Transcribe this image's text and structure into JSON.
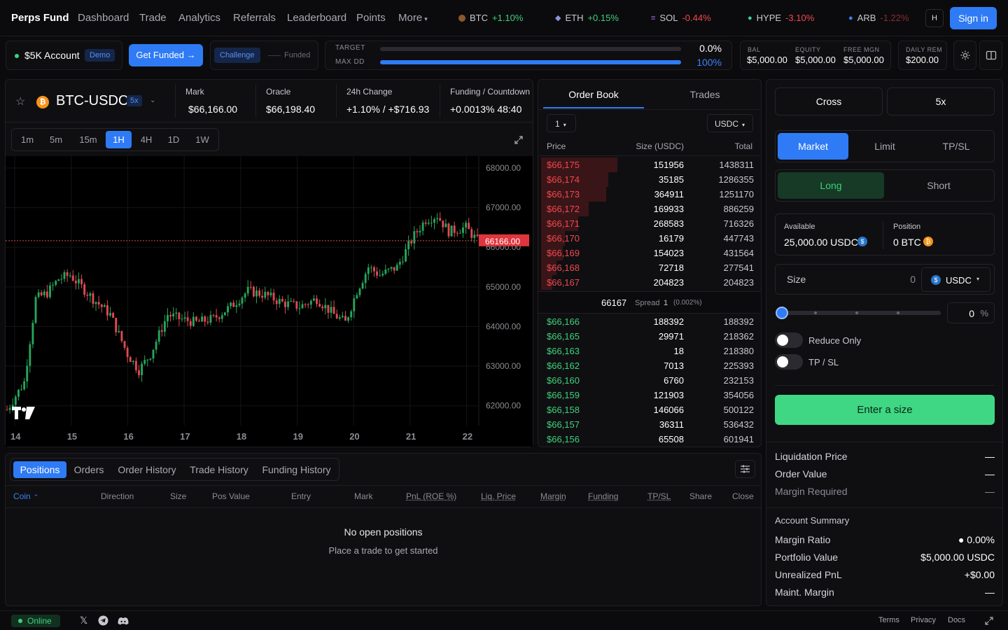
{
  "nav": {
    "brand": "Perps Fund",
    "links": [
      "Dashboard",
      "Trade",
      "Analytics",
      "Referrals",
      "Leaderboard",
      "Points",
      "More"
    ],
    "tickers": [
      {
        "sym": "BTC",
        "chg": "+1.10%",
        "dir": "up",
        "color": "#8a5a2b"
      },
      {
        "sym": "ETH",
        "chg": "+0.15%",
        "dir": "up",
        "color": "#6c7bd6"
      },
      {
        "sym": "SOL",
        "chg": "-0.44%",
        "dir": "down",
        "color": "#9b6cf0"
      },
      {
        "sym": "HYPE",
        "chg": "-3.10%",
        "dir": "down",
        "color": "#36d3a5"
      },
      {
        "sym": "ARB",
        "chg": "-1.22%",
        "dir": "down",
        "color": "#3b82f6"
      }
    ],
    "h_label": "H",
    "signin": "Sign in"
  },
  "account": {
    "name": "$5K Account",
    "badge": "Demo",
    "get_funded": "Get Funded →",
    "challenge": "Challenge",
    "funded": "Funded",
    "target_label": "TARGET",
    "target_value": "0.0%",
    "target_progress": 0.0,
    "maxdd_label": "MAX DD",
    "maxdd_value": "100%",
    "maxdd_progress": 1.0,
    "stats": [
      {
        "label": "BAL",
        "value": "$5,000.00"
      },
      {
        "label": "EQUITY",
        "value": "$5,000.00"
      },
      {
        "label": "FREE MGN",
        "value": "$5,000.00"
      }
    ],
    "daily_label": "DAILY REM",
    "daily_value": "$200.00"
  },
  "market": {
    "pair": "BTC-USDC",
    "leverage": "5x",
    "mark_label": "Mark",
    "mark": "$66,166.00",
    "oracle_label": "Oracle",
    "oracle": "$66,198.40",
    "change_label": "24h Change",
    "change": "+1.10% / +$716.93",
    "funding_label": "Funding / Countdown",
    "funding": "+0.0013% 48:40"
  },
  "timeframes": [
    "1m",
    "5m",
    "15m",
    "1H",
    "4H",
    "1D",
    "1W"
  ],
  "active_timeframe": "1H",
  "chart_data": {
    "type": "candlestick",
    "y_ticks": [
      "68000.00",
      "67000.00",
      "66000.00",
      "65000.00",
      "64000.00",
      "63000.00",
      "62000.00"
    ],
    "x_ticks": [
      "14",
      "15",
      "16",
      "17",
      "18",
      "19",
      "20",
      "21",
      "22"
    ],
    "last_price_label": "66166.00",
    "last_price": 66166,
    "ylim": [
      61500,
      68300
    ],
    "trend": [
      [
        0,
        61900
      ],
      [
        6,
        62600
      ],
      [
        10,
        64700
      ],
      [
        14,
        64850
      ],
      [
        18,
        65200
      ],
      [
        22,
        65300
      ],
      [
        26,
        65000
      ],
      [
        30,
        64700
      ],
      [
        36,
        64300
      ],
      [
        42,
        63300
      ],
      [
        46,
        62900
      ],
      [
        50,
        63300
      ],
      [
        56,
        64300
      ],
      [
        60,
        64200
      ],
      [
        66,
        64100
      ],
      [
        72,
        64200
      ],
      [
        78,
        64500
      ],
      [
        84,
        64900
      ],
      [
        90,
        64800
      ],
      [
        96,
        64600
      ],
      [
        102,
        64500
      ],
      [
        108,
        64700
      ],
      [
        114,
        64300
      ],
      [
        118,
        64100
      ],
      [
        122,
        64900
      ],
      [
        126,
        65500
      ],
      [
        130,
        65300
      ],
      [
        136,
        65500
      ],
      [
        142,
        66300
      ],
      [
        146,
        66700
      ],
      [
        150,
        66800
      ],
      [
        154,
        66400
      ],
      [
        160,
        66500
      ],
      [
        164,
        66166
      ]
    ],
    "candle_count": 165
  },
  "orderbook": {
    "tab_book": "Order Book",
    "tab_trades": "Trades",
    "tick": "1",
    "unit": "USDC",
    "col_price": "Price",
    "col_size": "Size (USDC)",
    "col_total": "Total",
    "asks": [
      {
        "price": "$66,175",
        "size": "151956",
        "total": "1438311",
        "depth": 0.35
      },
      {
        "price": "$66,174",
        "size": "35185",
        "total": "1286355",
        "depth": 0.31
      },
      {
        "price": "$66,173",
        "size": "364911",
        "total": "1251170",
        "depth": 0.3
      },
      {
        "price": "$66,172",
        "size": "169933",
        "total": "886259",
        "depth": 0.22
      },
      {
        "price": "$66,171",
        "size": "268583",
        "total": "716326",
        "depth": 0.17
      },
      {
        "price": "$66,170",
        "size": "16179",
        "total": "447743",
        "depth": 0.11
      },
      {
        "price": "$66,169",
        "size": "154023",
        "total": "431564",
        "depth": 0.1
      },
      {
        "price": "$66,168",
        "size": "72718",
        "total": "277541",
        "depth": 0.07
      },
      {
        "price": "$66,167",
        "size": "204823",
        "total": "204823",
        "depth": 0.05
      }
    ],
    "mid": "66167",
    "spread_label": "Spread",
    "spread_value": "1",
    "spread_pct": "(0.002%)",
    "bids": [
      {
        "price": "$66,166",
        "size": "188392",
        "total": "188392"
      },
      {
        "price": "$66,165",
        "size": "29971",
        "total": "218362"
      },
      {
        "price": "$66,163",
        "size": "18",
        "total": "218380"
      },
      {
        "price": "$66,162",
        "size": "7013",
        "total": "225393"
      },
      {
        "price": "$66,160",
        "size": "6760",
        "total": "232153"
      },
      {
        "price": "$66,159",
        "size": "121903",
        "total": "354056"
      },
      {
        "price": "$66,158",
        "size": "146066",
        "total": "500122"
      },
      {
        "price": "$66,157",
        "size": "36311",
        "total": "536432"
      },
      {
        "price": "$66,156",
        "size": "65508",
        "total": "601941"
      }
    ]
  },
  "order": {
    "margin_mode": "Cross",
    "leverage": "5x",
    "types": [
      "Market",
      "Limit",
      "TP/SL"
    ],
    "long": "Long",
    "short": "Short",
    "available_label": "Available",
    "available": "25,000.00 USDC",
    "position_label": "Position",
    "position": "0 BTC",
    "size_label": "Size",
    "size_value": "0",
    "size_unit": "USDC",
    "pct_value": "0",
    "pct_sign": "%",
    "reduce_only": "Reduce Only",
    "tpsl": "TP / SL",
    "submit": "Enter a size",
    "liq_label": "Liquidation Price",
    "liq": "—",
    "ov_label": "Order Value",
    "ov": "—",
    "mr_label": "Margin Required",
    "mr": "—",
    "summary_title": "Account Summary",
    "summary": [
      {
        "label": "Margin Ratio",
        "value": "● 0.00%"
      },
      {
        "label": "Portfolio Value",
        "value": "$5,000.00 USDC"
      },
      {
        "label": "Unrealized PnL",
        "value": "+$0.00"
      },
      {
        "label": "Maint. Margin",
        "value": "—"
      }
    ]
  },
  "bottom": {
    "tabs": [
      "Positions",
      "Orders",
      "Order History",
      "Trade History",
      "Funding History"
    ],
    "columns": [
      "Coin",
      "Direction",
      "Size",
      "Pos Value",
      "Entry",
      "Mark",
      "PnL (ROE %)",
      "Liq. Price",
      "Margin",
      "Funding",
      "TP/SL",
      "Share",
      "Close"
    ],
    "empty_title": "No open positions",
    "empty_sub": "Place a trade to get started"
  },
  "footer": {
    "status": "Online",
    "links": [
      "Terms",
      "Privacy",
      "Docs"
    ]
  }
}
